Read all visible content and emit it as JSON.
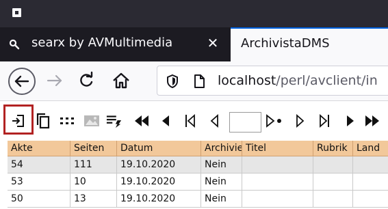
{
  "browser": {
    "tabs": [
      {
        "title": "searx by AVMultimedia",
        "close": "✕",
        "icon": "magnifier-icon"
      },
      {
        "title": "ArchivistaDMS"
      }
    ],
    "url": {
      "host": "localhost",
      "path": "/perl/avclient/in"
    }
  },
  "toolbar": {
    "icons": [
      "login-icon",
      "copy-icon",
      "grid-dots-icon",
      "image-icon",
      "list-action-icon",
      "fast-backward-icon",
      "step-backward-icon",
      "first-page-icon",
      "previous-icon",
      "next-dot-icon",
      "next-icon",
      "last-page-icon",
      "play-icon",
      "fast-forward-icon"
    ],
    "page_value": ""
  },
  "table": {
    "columns": [
      "Akte",
      "Seiten",
      "Datum",
      "Archivie",
      "Titel",
      "Rubrik",
      "Land"
    ],
    "rows": [
      [
        "54",
        "111",
        "19.10.2020",
        "Nein",
        "",
        "",
        ""
      ],
      [
        "53",
        "10",
        "19.10.2020",
        "Nein",
        "",
        "",
        ""
      ],
      [
        "50",
        "13",
        "19.10.2020",
        "Nein",
        "",
        "",
        ""
      ]
    ]
  },
  "colors": {
    "highlight": "#b22222",
    "header_bg": "#f2c89a",
    "selected_row": "#e6e6e6",
    "tab_accent": "#0061e0"
  }
}
